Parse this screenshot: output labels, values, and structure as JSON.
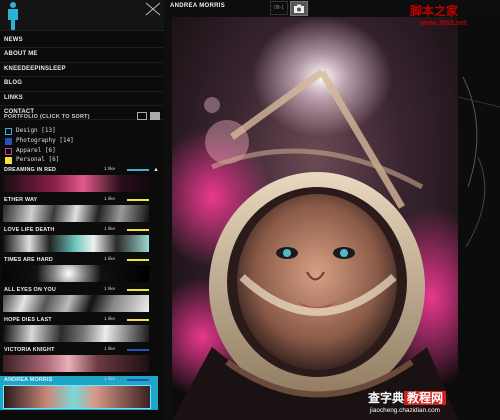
{
  "header": {
    "project_title": "ANDREA MORRIS",
    "counter": "08-1",
    "camera_icon": "camera-icon"
  },
  "nav": [
    {
      "label": "NEWS"
    },
    {
      "label": "ABOUT ME"
    },
    {
      "label": "KNEEDEEPINSLEEP"
    },
    {
      "label": "BLOG"
    },
    {
      "label": "LINKS"
    },
    {
      "label": "CONTACT"
    }
  ],
  "portfolio": {
    "heading": "PORTFOLIO (CLICK TO SORT)",
    "categories": [
      {
        "label": "Design [13]",
        "color": "#3ab0d8"
      },
      {
        "label": "Photography [14]",
        "color": "#2a4fb8"
      },
      {
        "label": "Apparel [6]",
        "color": "#d23a8e"
      },
      {
        "label": "Personal [6]",
        "color": "#f2e23a"
      }
    ]
  },
  "items": [
    {
      "title": "DREAMING IN RED",
      "likes": "1 like",
      "color": "#3ab0d8"
    },
    {
      "title": "ETHER WAY",
      "likes": "1 like",
      "color": "#f2e23a"
    },
    {
      "title": "LOVE LIFE DEATH",
      "likes": "1 like",
      "color": "#f2e23a"
    },
    {
      "title": "TIMES ARE HARD",
      "likes": "1 like",
      "color": "#f2e23a"
    },
    {
      "title": "ALL EYES ON YOU",
      "likes": "1 like",
      "color": "#f2e23a"
    },
    {
      "title": "HOPE DIES LAST",
      "likes": "1 like",
      "color": "#f2e23a"
    },
    {
      "title": "VICTORIA KNIGHT",
      "likes": "1 like",
      "color": "#2a4fb8"
    },
    {
      "title": "ANDREA MORRIS",
      "likes": "1 like",
      "color": "#2a4fb8"
    }
  ],
  "watermarks": {
    "top": "脚本之家",
    "top_url": "www.Jb51.net",
    "bottom_a": "查字典",
    "bottom_b": "教程网",
    "bottom_url": "jiaocheng.chazidian.com"
  }
}
